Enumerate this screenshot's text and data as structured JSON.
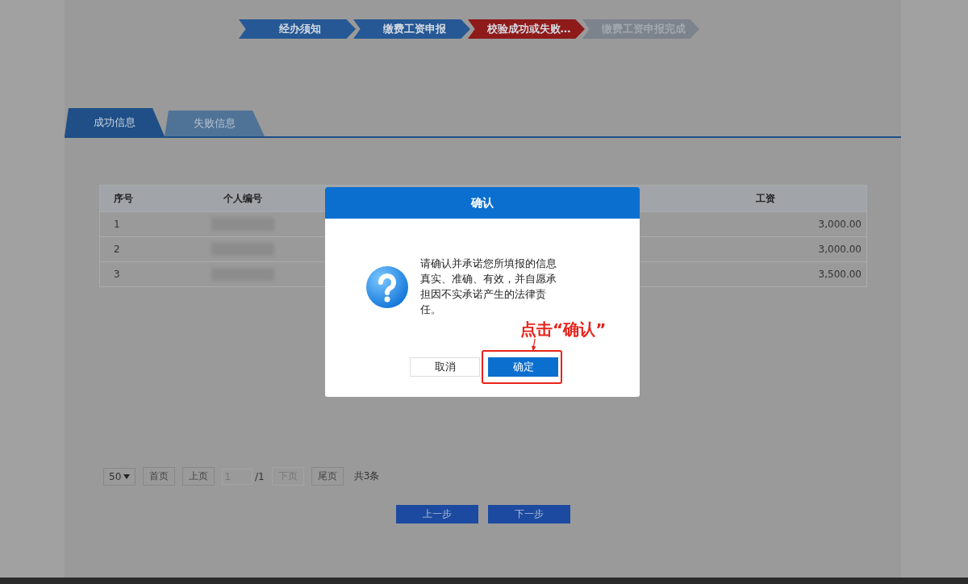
{
  "steps": [
    {
      "label": "经办须知",
      "current": false
    },
    {
      "label": "缴费工资申报",
      "current": false
    },
    {
      "label": "校验成功或失败…",
      "current": true
    },
    {
      "label": "缴费工资申报完成",
      "current": false
    }
  ],
  "tabs": [
    {
      "label": "成功信息",
      "selected": true
    },
    {
      "label": "失败信息",
      "selected": false
    }
  ],
  "table": {
    "columns": [
      "序号",
      "个人编号",
      "工资"
    ],
    "rows": [
      {
        "no": "1",
        "amount": "3,000.00"
      },
      {
        "no": "2",
        "amount": "3,000.00"
      },
      {
        "no": "3",
        "amount": "3,500.00"
      }
    ]
  },
  "pagination": {
    "page_size": "50",
    "page_input": "1",
    "total_pages": "/1",
    "count": "共3条",
    "buttons": [
      {
        "label": "首页",
        "disabled": false
      },
      {
        "label": "上页",
        "disabled": false
      }
    ],
    "buttons_after": [
      {
        "label": "下页",
        "disabled": true
      },
      {
        "label": "尾页",
        "disabled": false
      }
    ]
  },
  "nav_buttons": [
    "上一步",
    "下一步"
  ],
  "dialog": {
    "title": "确认",
    "message": "请确认并承诺您所填报的信息真实、准确、有效，并自愿承担因不实承诺产生的法律责任。",
    "buttons": [
      {
        "label": "取消",
        "kind": "secondary"
      },
      {
        "label": "确定",
        "kind": "primary"
      }
    ]
  },
  "annotation": {
    "text": "点击“确认”"
  }
}
